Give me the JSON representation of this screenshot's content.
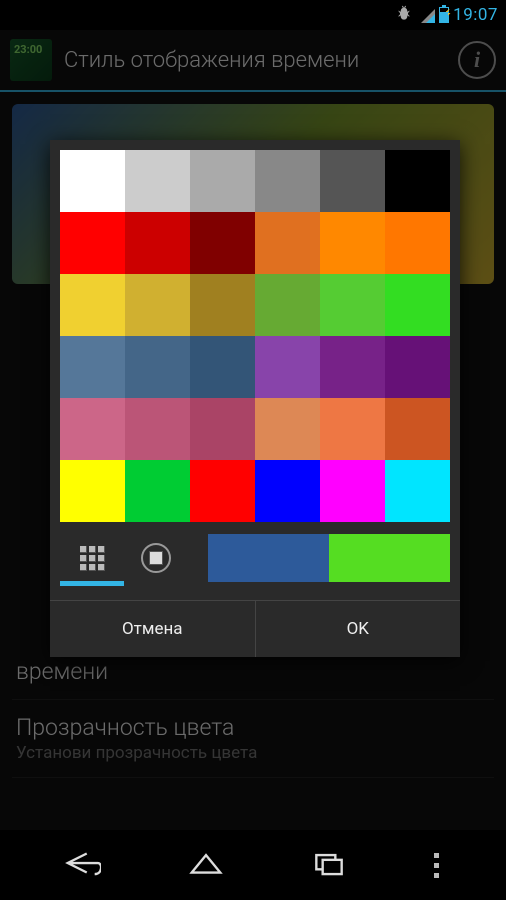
{
  "status": {
    "time": "19:07"
  },
  "header": {
    "app_icon_time": "23:00",
    "title": "Стиль отображения времени"
  },
  "background_settings": {
    "item1": {
      "title": "времени"
    },
    "item2": {
      "title": "Прозрачность цвета",
      "subtitle": "Установи прозрачность цвета"
    }
  },
  "dialog": {
    "colors": [
      "#ffffff",
      "#cccccc",
      "#aaaaaa",
      "#888888",
      "#555555",
      "#000000",
      "#ff0000",
      "#cc0000",
      "#800000",
      "#e07020",
      "#ff8800",
      "#ff7700",
      "#f0d030",
      "#d0b030",
      "#a08020",
      "#66aa33",
      "#55cc33",
      "#33dd22",
      "#557799",
      "#446688",
      "#335577",
      "#8844aa",
      "#772288",
      "#661177",
      "#cc6688",
      "#bb5577",
      "#aa4466",
      "#dd8855",
      "#ee7744",
      "#cc5522",
      "#ffff00",
      "#00cc33",
      "#ff0000",
      "#0000ff",
      "#ff00ff",
      "#00e5ff"
    ],
    "preview_colors": [
      "#2d5a9a",
      "#55dd22"
    ],
    "buttons": {
      "cancel": "Отмена",
      "ok": "OK"
    },
    "active_tab": 0
  }
}
